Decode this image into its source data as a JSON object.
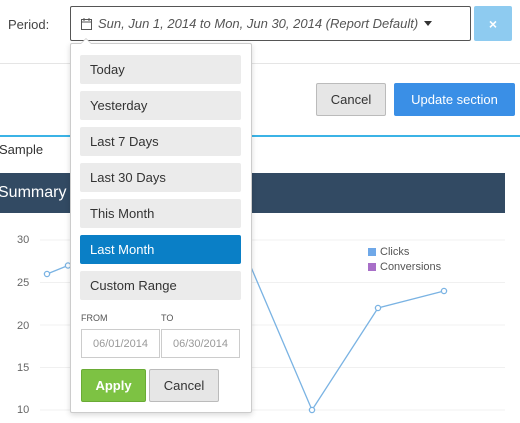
{
  "period": {
    "label": "Period:",
    "value": "Sun, Jun 1, 2014 to Mon, Jun 30, 2014 (Report Default)",
    "clear_icon": "×"
  },
  "actions": {
    "cancel_label": "Cancel",
    "update_label": "Update section"
  },
  "tabs": {
    "sample_label": "Sample"
  },
  "section": {
    "title": "Summary"
  },
  "daterange": {
    "ranges": [
      "Today",
      "Yesterday",
      "Last 7 Days",
      "Last 30 Days",
      "This Month",
      "Last Month",
      "Custom Range"
    ],
    "active_range": "Last Month",
    "from_label": "FROM",
    "to_label": "TO",
    "from_value": "06/01/2014",
    "to_value": "06/30/2014",
    "apply_label": "Apply",
    "cancel_label": "Cancel"
  },
  "colors": {
    "accent": "#3a8fe6",
    "active": "#0a7fc6",
    "apply": "#7dc243",
    "header": "#324a63",
    "line": "#7ab3e3"
  },
  "chart_data": {
    "type": "line",
    "yticks": [
      "30",
      "25",
      "20",
      "15",
      "10"
    ],
    "ylim": [
      10,
      30
    ],
    "legend": [
      {
        "name": "Clicks",
        "color": "#6fa8e8"
      },
      {
        "name": "Conversions",
        "color": "#a86fc8"
      }
    ],
    "series": [
      {
        "name": "Clicks",
        "values": [
          26,
          27,
          null,
          null,
          null,
          null,
          10,
          22,
          24
        ]
      }
    ]
  }
}
